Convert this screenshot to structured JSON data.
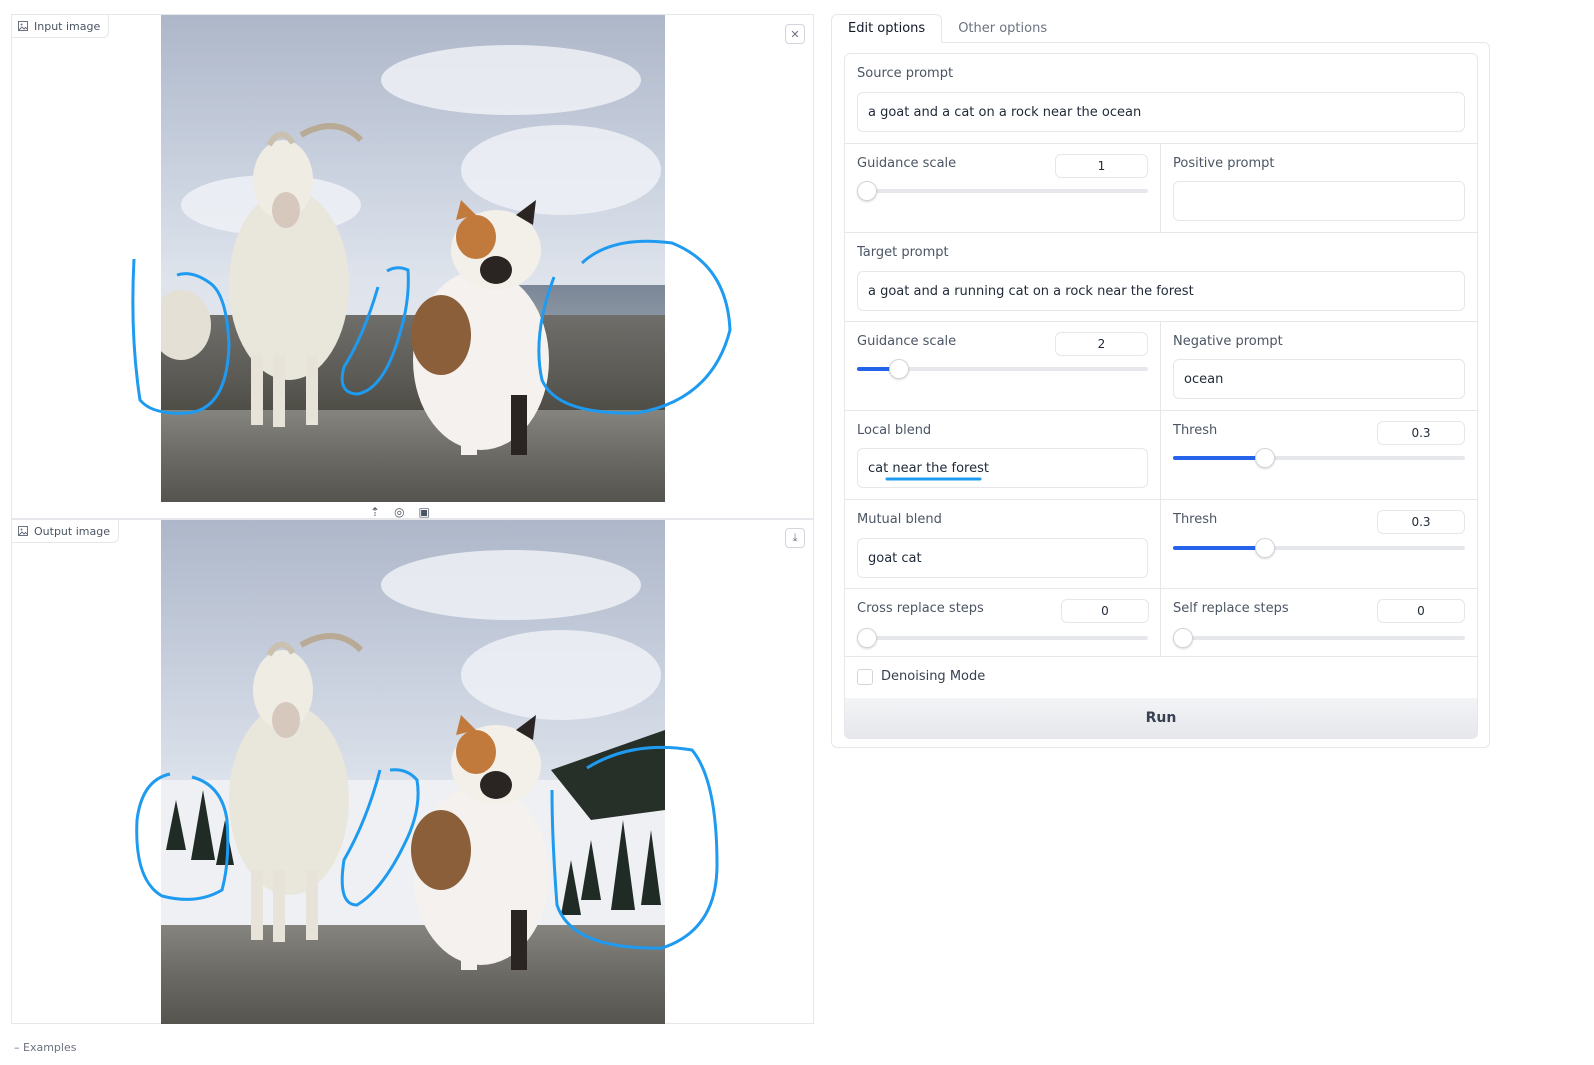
{
  "input_panel": {
    "label": "Input image",
    "label_icon": "image-icon",
    "clear_icon": "close-icon"
  },
  "output_panel": {
    "label": "Output image",
    "label_icon": "image-icon",
    "download_icon": "download-icon"
  },
  "image_toolbar": {
    "upload_icon": "upload-icon",
    "webcam_icon": "camera-icon",
    "paste_icon": "clipboard-icon"
  },
  "tabs": [
    {
      "label": "Edit options",
      "active": true
    },
    {
      "label": "Other options",
      "active": false
    }
  ],
  "form": {
    "source_prompt": {
      "label": "Source prompt",
      "value": "a goat and a cat on a rock near the ocean"
    },
    "guidance_scale_1": {
      "label": "Guidance scale",
      "value": "1",
      "fraction": 0.0
    },
    "positive_prompt": {
      "label": "Positive prompt",
      "value": ""
    },
    "target_prompt": {
      "label": "Target prompt",
      "value": "a goat and a running cat on a rock near the forest"
    },
    "guidance_scale_2": {
      "label": "Guidance scale",
      "value": "2",
      "fraction": 0.14
    },
    "negative_prompt": {
      "label": "Negative prompt",
      "value": "ocean"
    },
    "local_blend": {
      "label": "Local blend",
      "value_prefix": "cat ",
      "value_highlight": "near the forest"
    },
    "thresh_1": {
      "label": "Thresh",
      "value": "0.3",
      "fraction": 0.31
    },
    "mutual_blend": {
      "label": "Mutual blend",
      "value": "goat cat"
    },
    "thresh_2": {
      "label": "Thresh",
      "value": "0.3",
      "fraction": 0.31
    },
    "cross_replace_steps": {
      "label": "Cross replace steps",
      "value": "0",
      "fraction": 0.0
    },
    "self_replace_steps": {
      "label": "Self replace steps",
      "value": "0",
      "fraction": 0.0
    },
    "denoising_mode": {
      "label": "Denoising Mode",
      "checked": false
    },
    "run_label": "Run"
  },
  "examples_label": "Examples",
  "accent_color": "#2563eb",
  "annotation_color": "#1e9bf0"
}
